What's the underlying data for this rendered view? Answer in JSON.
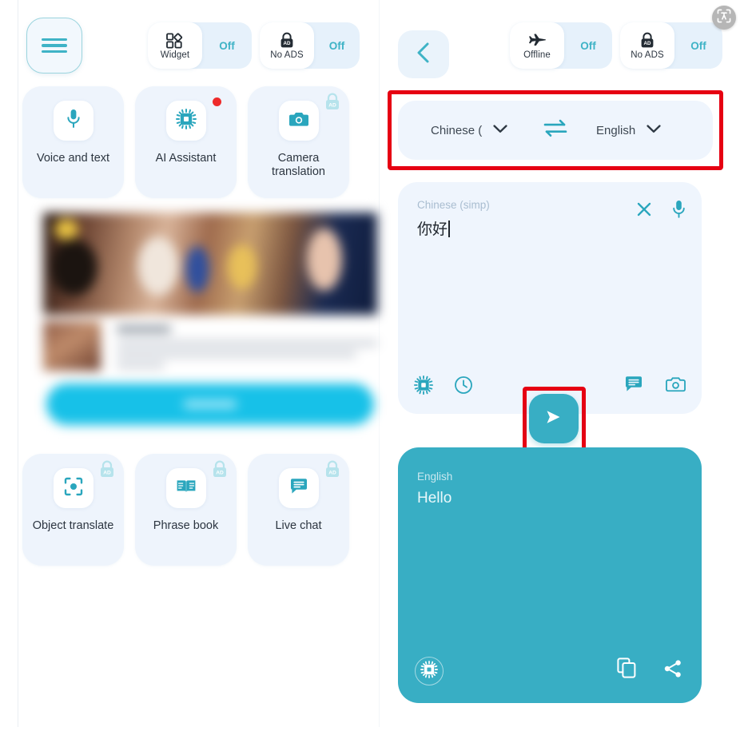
{
  "colors": {
    "teal": "#38aec4",
    "teal_accent": "#3fb3c6",
    "card_bg": "#eef4fc",
    "highlight_red": "#e60012",
    "badge_red": "#ee2b2b",
    "cta_cyan": "#17c1e8"
  },
  "left_pane": {
    "menu_button": {
      "name": "menu",
      "icon": "hamburger-icon"
    },
    "toggles": [
      {
        "id": "widget",
        "label": "Widget",
        "state": "Off",
        "icon": "widget-grid-icon"
      },
      {
        "id": "no_ads",
        "label": "No ADS",
        "state": "Off",
        "icon": "lock-ad-icon"
      }
    ],
    "feature_cards_row1": [
      {
        "id": "voice_and_text",
        "label": "Voice and text",
        "icon": "microphone-icon",
        "locked": false,
        "badge": false
      },
      {
        "id": "ai_assistant",
        "label": "AI Assistant",
        "icon": "ai-chip-icon",
        "locked": false,
        "badge": true
      },
      {
        "id": "camera_translation",
        "label": "Camera translation",
        "icon": "camera-icon",
        "locked": true,
        "badge": false
      }
    ],
    "feature_cards_row2": [
      {
        "id": "object_translate",
        "label": "Object translate",
        "icon": "object-scan-icon",
        "locked": true,
        "badge": false
      },
      {
        "id": "phrase_book",
        "label": "Phrase book",
        "icon": "open-book-icon",
        "locked": true,
        "badge": false
      },
      {
        "id": "live_chat",
        "label": "Live chat",
        "icon": "chat-bubble-icon",
        "locked": true,
        "badge": false
      }
    ],
    "advertisement": {
      "name": "blurred-ad-banner",
      "cta_label": ""
    }
  },
  "right_pane": {
    "back_button": {
      "icon": "chevron-left-icon"
    },
    "toggles": [
      {
        "id": "offline",
        "label": "Offline",
        "state": "Off",
        "icon": "airplane-icon"
      },
      {
        "id": "no_ads",
        "label": "No ADS",
        "state": "Off",
        "icon": "lock-ad-icon"
      }
    ],
    "language_bar": {
      "source": "Chinese (",
      "target": "English",
      "swap_icon": "swap-arrows-icon",
      "highlighted": true
    },
    "input_card": {
      "source_label": "Chinese (simp)",
      "text": "你好",
      "clear_icon": "close-x-icon",
      "mic_icon": "microphone-icon",
      "footer_left_icons": [
        "ai-chip-icon",
        "history-clock-icon"
      ],
      "footer_right_icons": [
        "chat-bubble-icon",
        "camera-icon"
      ]
    },
    "send_button": {
      "icon": "send-arrow-icon",
      "highlighted": true
    },
    "output_card": {
      "target_label": "English",
      "text": "Hello",
      "ai_icon": "ai-chip-icon",
      "copy_icon": "copy-icon",
      "share_icon": "share-icon"
    }
  },
  "overlay": {
    "scan_fab": {
      "icon": "scan-frame-icon"
    }
  }
}
